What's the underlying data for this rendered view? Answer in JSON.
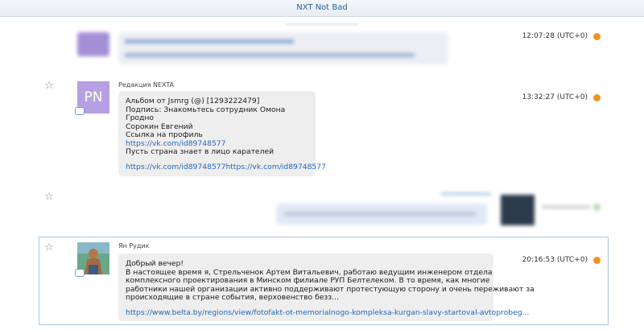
{
  "window": {
    "title": "NXT Not Bad"
  },
  "messages": [
    {
      "id": "m1",
      "time": "12:07:28 (UTC+0)",
      "blurred": true
    },
    {
      "id": "m2",
      "sender": "Редакция NEXTA",
      "avatar_initials": "PN",
      "lines": [
        "Альбом от Jsmrg  (@) [1293222479]",
        "Подпись: Знакомьтесь сотрудник Омона",
        "Гродно",
        "Сорокин Евгений",
        "Ссылка на профиль"
      ],
      "link1": "https://vk.com/id89748577",
      "line_after_link": "Пусть страна знает в лицо карателей",
      "link2": "https://vk.com/id89748577https://vk.com/id89748577",
      "time": "13:32:27 (UTC+0)"
    },
    {
      "id": "m3",
      "outgoing": true,
      "blurred": true
    },
    {
      "id": "m4",
      "sender": "Ян Рудик",
      "lines": [
        "Добрый вечер!",
        "В настоящее время я, Стрельченок Артем Витальевич, работаю ведущим инженером отдела",
        "комплексного проектирования в Минском филиале РУП Белтелеком. В то время, как многие",
        "работники нашей организации активно поддерживают протестующую сторону и очень переживают за",
        "происходящие в стране события, верховенство безз..."
      ],
      "link": "https://www.belta.by/regions/view/fotofakt-ot-memorialnogo-kompleksa-kurgan-slavy-startoval-avtoprobeg...",
      "time": "20:16:53 (UTC+0)"
    }
  ],
  "icons": {
    "star": "star-icon",
    "comment": "comment-icon",
    "clock": "clock-icon"
  },
  "colors": {
    "accent": "#2d5e9a",
    "link": "#2766b8",
    "bubble": "#eeeeee",
    "clock": "#f0931f",
    "avatar_pn": "#b6a0e3"
  }
}
